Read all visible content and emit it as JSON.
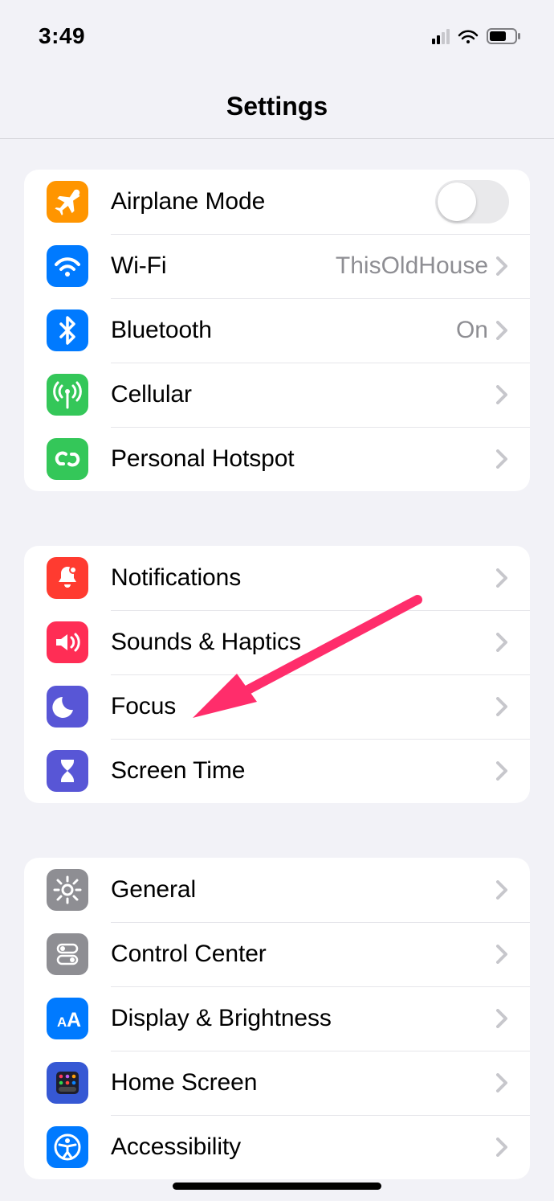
{
  "status": {
    "time": "3:49"
  },
  "header": {
    "title": "Settings"
  },
  "groups": [
    {
      "rows": [
        {
          "id": "airplane",
          "label": "Airplane Mode",
          "icon": "airplane-icon",
          "bg": "bg-orange",
          "control": "toggle",
          "toggle_on": false
        },
        {
          "id": "wifi",
          "label": "Wi-Fi",
          "icon": "wifi-icon",
          "bg": "bg-blue",
          "control": "disclosure",
          "value": "ThisOldHouse"
        },
        {
          "id": "bluetooth",
          "label": "Bluetooth",
          "icon": "bluetooth-icon",
          "bg": "bg-blue",
          "control": "disclosure",
          "value": "On"
        },
        {
          "id": "cellular",
          "label": "Cellular",
          "icon": "antenna-icon",
          "bg": "bg-green",
          "control": "disclosure"
        },
        {
          "id": "hotspot",
          "label": "Personal Hotspot",
          "icon": "link-icon",
          "bg": "bg-green",
          "control": "disclosure"
        }
      ]
    },
    {
      "rows": [
        {
          "id": "notifications",
          "label": "Notifications",
          "icon": "bell-icon",
          "bg": "bg-red",
          "control": "disclosure"
        },
        {
          "id": "sounds",
          "label": "Sounds & Haptics",
          "icon": "speaker-icon",
          "bg": "bg-pink",
          "control": "disclosure"
        },
        {
          "id": "focus",
          "label": "Focus",
          "icon": "moon-icon",
          "bg": "bg-indigo",
          "control": "disclosure"
        },
        {
          "id": "screentime",
          "label": "Screen Time",
          "icon": "hourglass-icon",
          "bg": "bg-indigo",
          "control": "disclosure"
        }
      ]
    },
    {
      "rows": [
        {
          "id": "general",
          "label": "General",
          "icon": "gear-icon",
          "bg": "bg-grey",
          "control": "disclosure"
        },
        {
          "id": "controlcenter",
          "label": "Control Center",
          "icon": "toggles-icon",
          "bg": "bg-grey",
          "control": "disclosure"
        },
        {
          "id": "display",
          "label": "Display & Brightness",
          "icon": "textsize-icon",
          "bg": "bg-blue",
          "control": "disclosure"
        },
        {
          "id": "homescreen",
          "label": "Home Screen",
          "icon": "apps-grid-icon",
          "bg": "bg-hs",
          "control": "disclosure"
        },
        {
          "id": "accessibility",
          "label": "Accessibility",
          "icon": "accessibility-icon",
          "bg": "bg-blue",
          "control": "disclosure"
        }
      ]
    }
  ],
  "annotation": {
    "target_row_id": "focus",
    "color": "#ff2d6b"
  }
}
